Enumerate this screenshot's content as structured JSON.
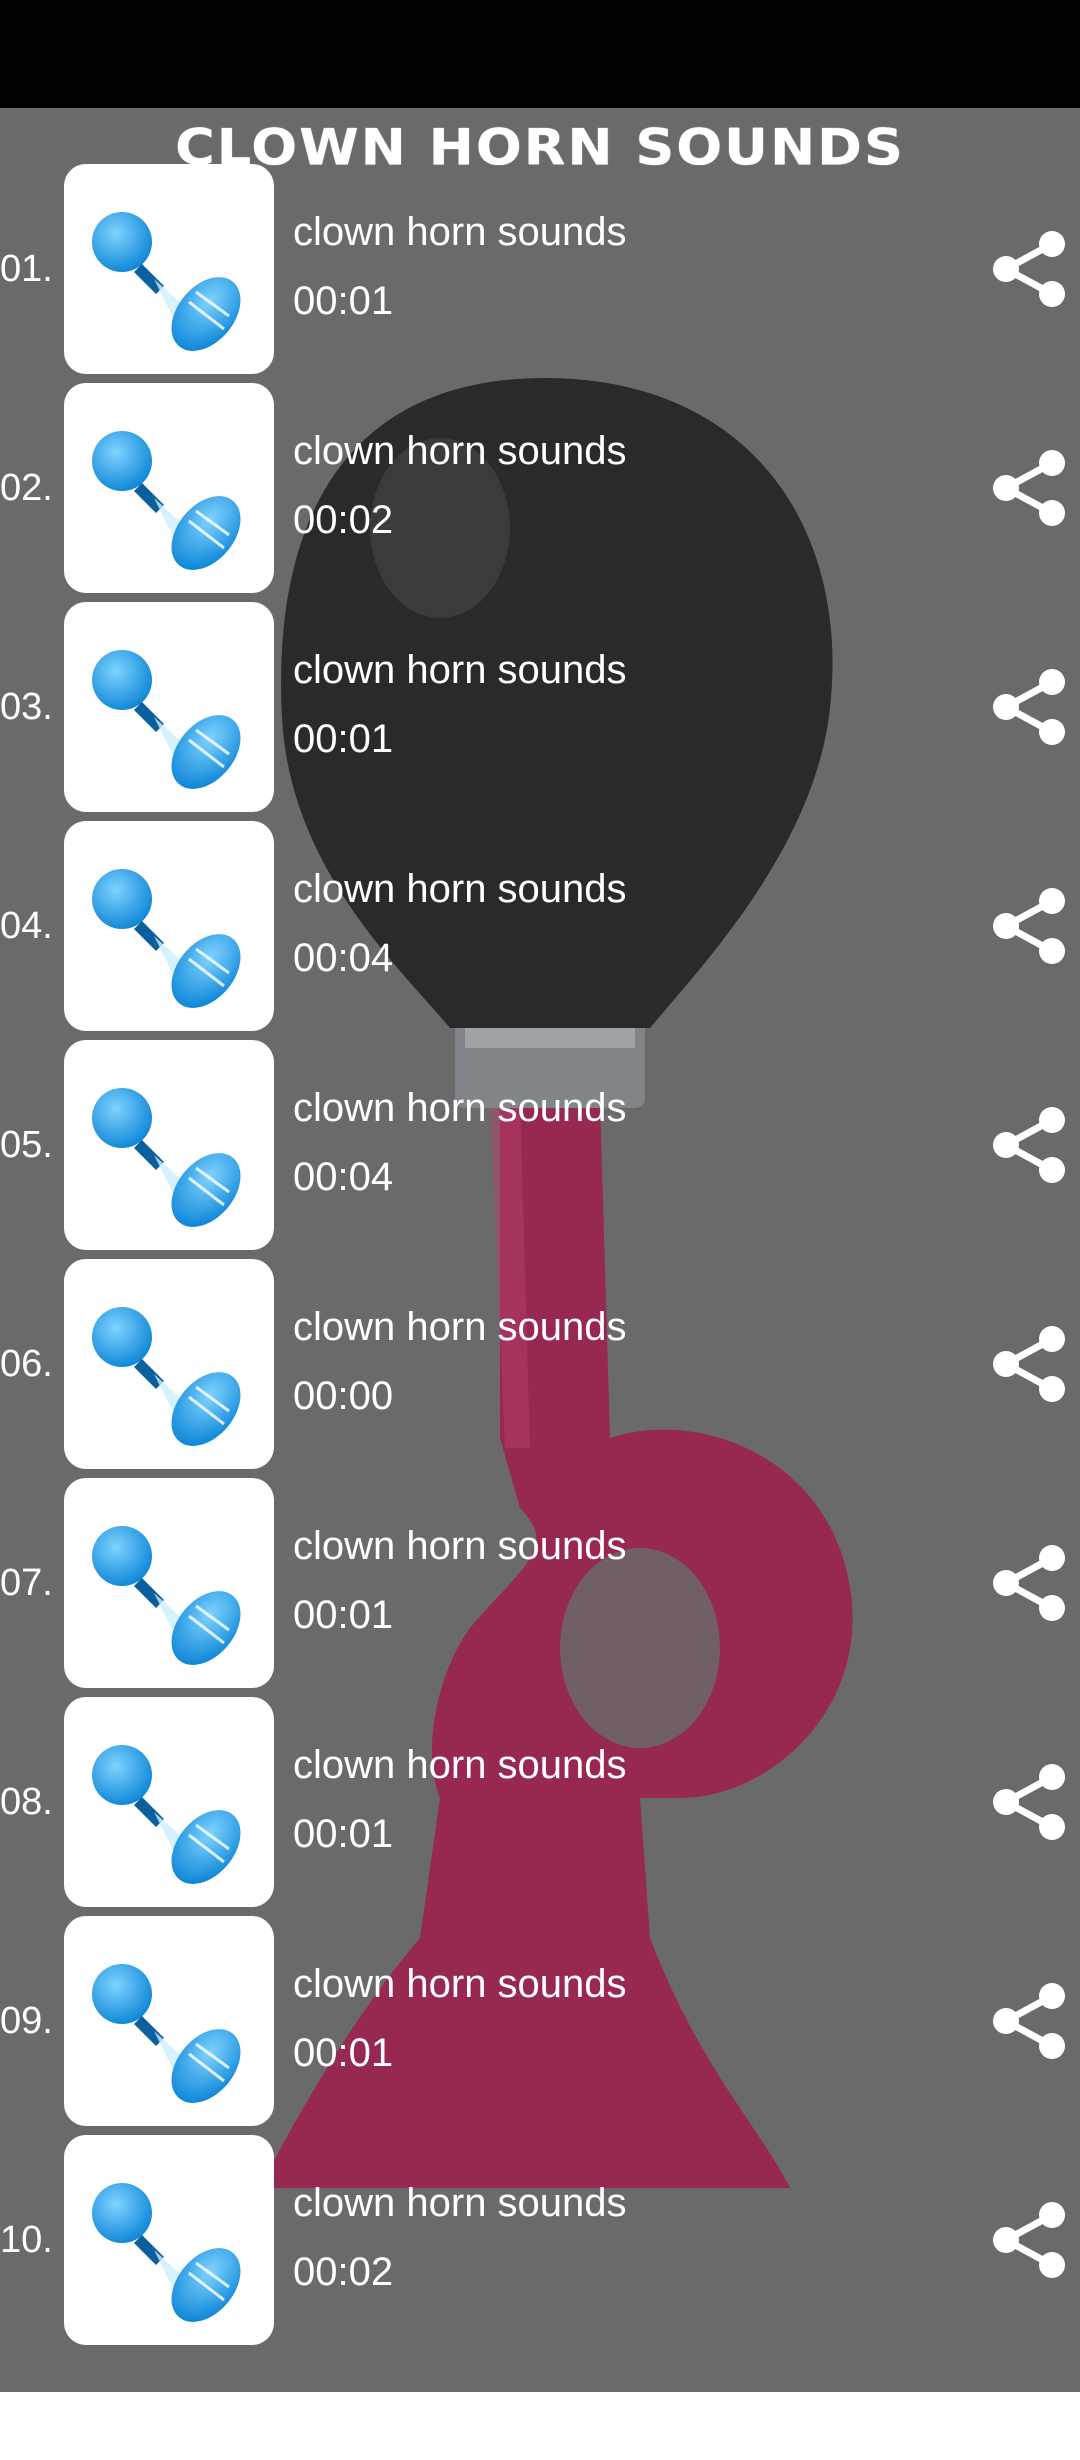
{
  "app": {
    "title": "CLOWN HORN SOUNDS"
  },
  "colors": {
    "background": "#6a6a6a",
    "status_bar": "#000000",
    "text": "#ffffff",
    "horn_bulb": "#111111",
    "horn_body": "#b0104f"
  },
  "sounds": [
    {
      "num": "01.",
      "title": "clown horn sounds",
      "duration": "00:01"
    },
    {
      "num": "02.",
      "title": "clown horn sounds",
      "duration": "00:02"
    },
    {
      "num": "03.",
      "title": "clown horn sounds",
      "duration": "00:01"
    },
    {
      "num": "04.",
      "title": "clown horn sounds",
      "duration": "00:04"
    },
    {
      "num": "05.",
      "title": "clown horn sounds",
      "duration": "00:04"
    },
    {
      "num": "06.",
      "title": "clown horn sounds",
      "duration": "00:00"
    },
    {
      "num": "07.",
      "title": "clown horn sounds",
      "duration": "00:01"
    },
    {
      "num": "08.",
      "title": "clown horn sounds",
      "duration": "00:01"
    },
    {
      "num": "09.",
      "title": "clown horn sounds",
      "duration": "00:01"
    },
    {
      "num": "10.",
      "title": "clown horn sounds",
      "duration": "00:02"
    }
  ],
  "icons": {
    "thumbnail": "horn-icon",
    "share": "share-icon"
  }
}
